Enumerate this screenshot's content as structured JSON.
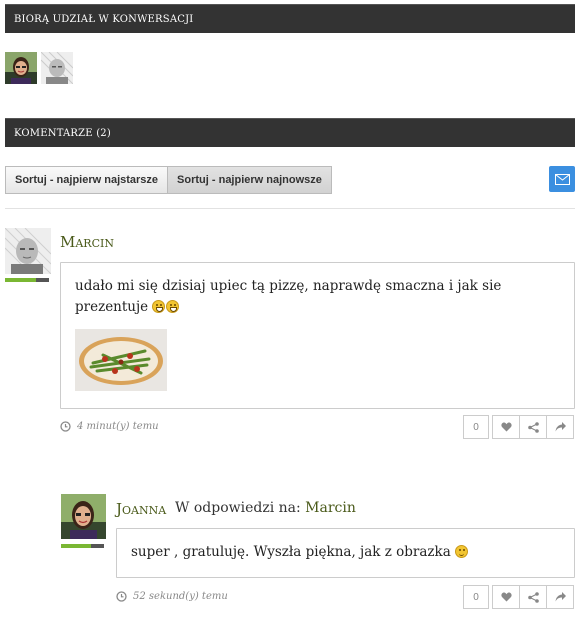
{
  "participants_header": "Biorą udział w konwersacji",
  "participants": [
    {
      "name": "Joanna",
      "avatar": "woman-avatar"
    },
    {
      "name": "Marcin",
      "avatar": "man-avatar"
    }
  ],
  "comments_header": "Komentarze (2)",
  "sort": {
    "oldest_label": "Sortuj - najpierw najstarsze",
    "newest_label": "Sortuj - najpierw najnowsze"
  },
  "subscribe_icon": "envelope-icon",
  "comments": [
    {
      "author": "Marcin",
      "text": "udało mi się dzisiaj upiec tą pizzę, naprawdę smaczna i jak sie prezentuje",
      "emoji": [
        "grin",
        "grin"
      ],
      "image": "pizza-photo",
      "time": "4 minut(y) temu",
      "votes": "0",
      "reputation": 0.7
    },
    {
      "author": "Joanna",
      "reply_prefix": "W odpowiedzi na:",
      "reply_to": "Marcin",
      "text": "super , gratuluję. Wyszła piękna, jak z obrazka",
      "emoji": [
        "wink"
      ],
      "time": "52 sekund(y) temu",
      "votes": "0",
      "reputation": 0.7
    }
  ],
  "colors": {
    "header_bg": "#333333",
    "author": "#4a5a1a",
    "reputation": "#7ab733",
    "subscribe": "#3b8fe0"
  }
}
